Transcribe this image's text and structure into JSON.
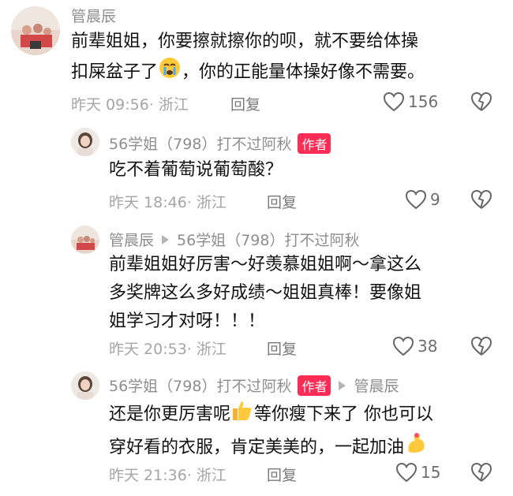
{
  "comments": [
    {
      "author": "管晨辰",
      "text_lines": [
        "前辈姐姐，你要擦就擦你的呗，就不要给体操",
        "扣屎盆子了",
        "，你的正能量体操好像不需要。"
      ],
      "time": "昨天 09:56",
      "location": "浙江",
      "reply_label": "回复",
      "likes": "156",
      "emoji": "crying-face"
    },
    {
      "author": "56学姐（798）打不过阿秋",
      "badge": "作者",
      "text": "吃不着葡萄说葡萄酸？",
      "time": "昨天 18:46",
      "location": "浙江",
      "reply_label": "回复",
      "likes": "9"
    },
    {
      "author": "管晨辰",
      "reply_to": "56学姐（798）打不过阿秋",
      "text_lines": [
        "前辈姐姐好厉害～好羡慕姐姐啊～拿这么",
        "多奖牌这么多好成绩～姐姐真棒！要像姐",
        "姐学习才对呀！！！"
      ],
      "time": "昨天 20:53",
      "location": "浙江",
      "reply_label": "回复",
      "likes": "38"
    },
    {
      "author": "56学姐（798）打不过阿秋",
      "badge": "作者",
      "reply_to": "管晨辰",
      "text_lines": [
        "还是你更厉害呢",
        "等你瘦下来了 你也可以",
        "穿好看的衣服，肯定美美的，一起加油"
      ],
      "time": "昨天 21:36",
      "location": "浙江",
      "reply_label": "回复",
      "likes": "15",
      "emojis": [
        "thumbs-up",
        "flexed-biceps"
      ]
    }
  ]
}
